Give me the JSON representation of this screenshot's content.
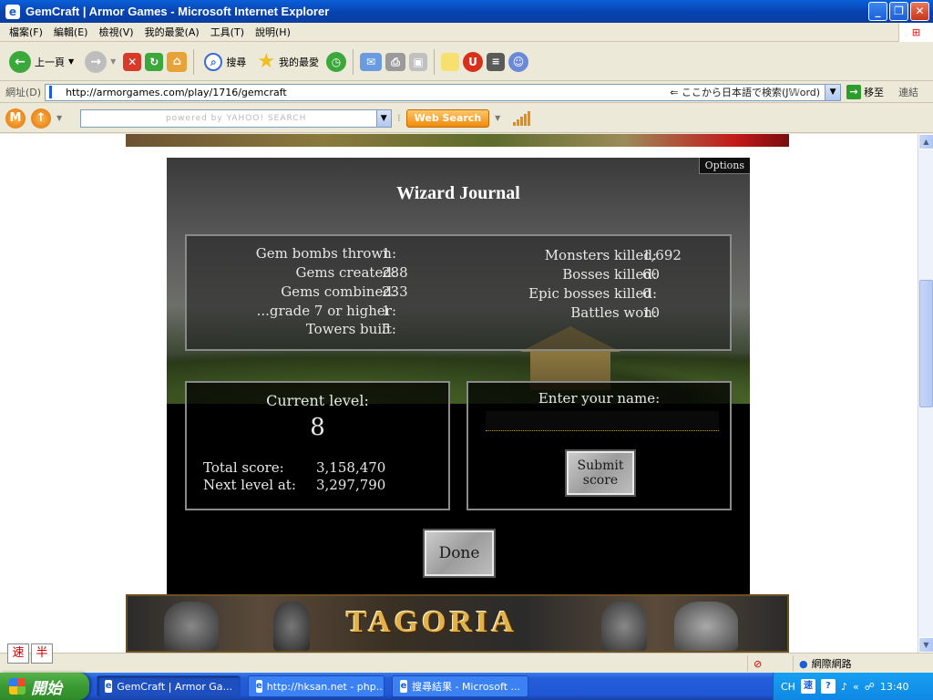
{
  "window": {
    "title": "GemCraft | Armor Games - Microsoft Internet Explorer"
  },
  "menu": [
    "檔案(F)",
    "編輯(E)",
    "檢視(V)",
    "我的最愛(A)",
    "工具(T)",
    "說明(H)"
  ],
  "toolbar": {
    "back_label": "上一頁",
    "search_label": "搜尋",
    "favorites_label": "我的最愛"
  },
  "address": {
    "label": "網址(D)",
    "url": "http://armorgames.com/play/1716/gemcraft",
    "hint": "⇐ ここから日本語で検索(J𝕎ord)",
    "go_label": "移至",
    "links_label": "連結"
  },
  "yahoo": {
    "search_placeholder": "powered by YAHOO! SEARCH",
    "web_search_label": "Web Search"
  },
  "game": {
    "options_label": "Options",
    "title": "Wizard Journal",
    "stats_left": [
      {
        "label": "Gem bombs thrown:",
        "value": "1"
      },
      {
        "label": "Gems created:",
        "value": "288"
      },
      {
        "label": "Gems combined:",
        "value": "233"
      },
      {
        "label": "...grade 7 or higher:",
        "value": "1"
      },
      {
        "label": "Towers built:",
        "value": "5"
      }
    ],
    "stats_right": [
      {
        "label": "Monsters killed:",
        "value": "1,692"
      },
      {
        "label": "Bosses killed:",
        "value": "60"
      },
      {
        "label": "Epic bosses killed:",
        "value": "0"
      },
      {
        "label": "Battles won:",
        "value": "10"
      }
    ],
    "current_level_label": "Current level:",
    "current_level": "8",
    "total_score_label": "Total score:",
    "total_score": "3,158,470",
    "next_level_label": "Next level at:",
    "next_level": "3,297,790",
    "enter_name_label": "Enter your name:",
    "name_value": "",
    "submit_line1": "Submit",
    "submit_line2": "score",
    "done_label": "Done"
  },
  "ad": {
    "tagoria": "TAGORIA"
  },
  "ime": {
    "a": "速",
    "b": "半"
  },
  "status": {
    "zone": "網際網路"
  },
  "taskbar": {
    "start_label": "開始",
    "tasks": [
      "GemCraft | Armor Ga...",
      "http://hksan.net - php...",
      "搜尋結果 - Microsoft ..."
    ],
    "lang": "CH",
    "time": "13:40"
  }
}
